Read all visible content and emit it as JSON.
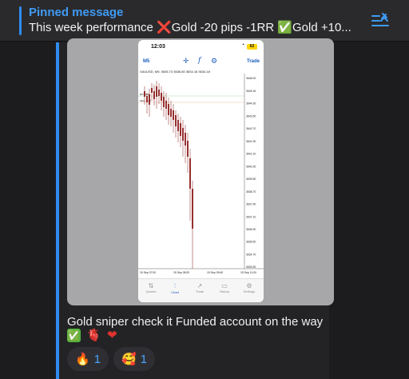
{
  "pinned": {
    "title": "Pinned message",
    "text_prefix": "This week performance ",
    "cross": "❌",
    "text_mid": "Gold -20 pips -1RR ",
    "check": "✅",
    "text_suffix": "Gold +10..."
  },
  "photo": {
    "status_time": "12:03",
    "battery": "62",
    "timeframe": "M5",
    "trade_label": "Trade",
    "symbol_header": "XAUUSD, M5: 3636.73 3636.80 3634.18 3634.18",
    "chart_labels": {
      "sell": "SELL 1.00",
      "buy": "BUY 0.01"
    },
    "price_ticks": [
      "3646.00",
      "3645.16",
      "3644.30",
      "3643.50",
      "3642.70",
      "3641.90",
      "3641.10",
      "3640.30",
      "3639.50",
      "3638.70",
      "3637.90",
      "3637.10",
      "3636.30",
      "3635.50",
      "3634.70",
      "3633.90"
    ],
    "time_ticks": [
      "15 Sep 07:00",
      "15 Sep 08:20",
      "15 Sep 09:40",
      "15 Sep 11:00"
    ],
    "tabs": [
      "Quotes",
      "Chart",
      "Trade",
      "History",
      "Settings"
    ]
  },
  "message": {
    "caption": "Gold sniper check it Funded account on the way",
    "emoji1": "✅",
    "emoji2": "🫀",
    "emoji3": "❤"
  },
  "reactions": [
    {
      "emoji": "🔥",
      "count": "1"
    },
    {
      "emoji": "🥰",
      "count": "1"
    }
  ],
  "colors": {
    "accent": "#2f8cf0",
    "link": "#3f9bf5",
    "bear_candle": "#8b1a1a",
    "bull_candle": "#1a2f8b"
  }
}
